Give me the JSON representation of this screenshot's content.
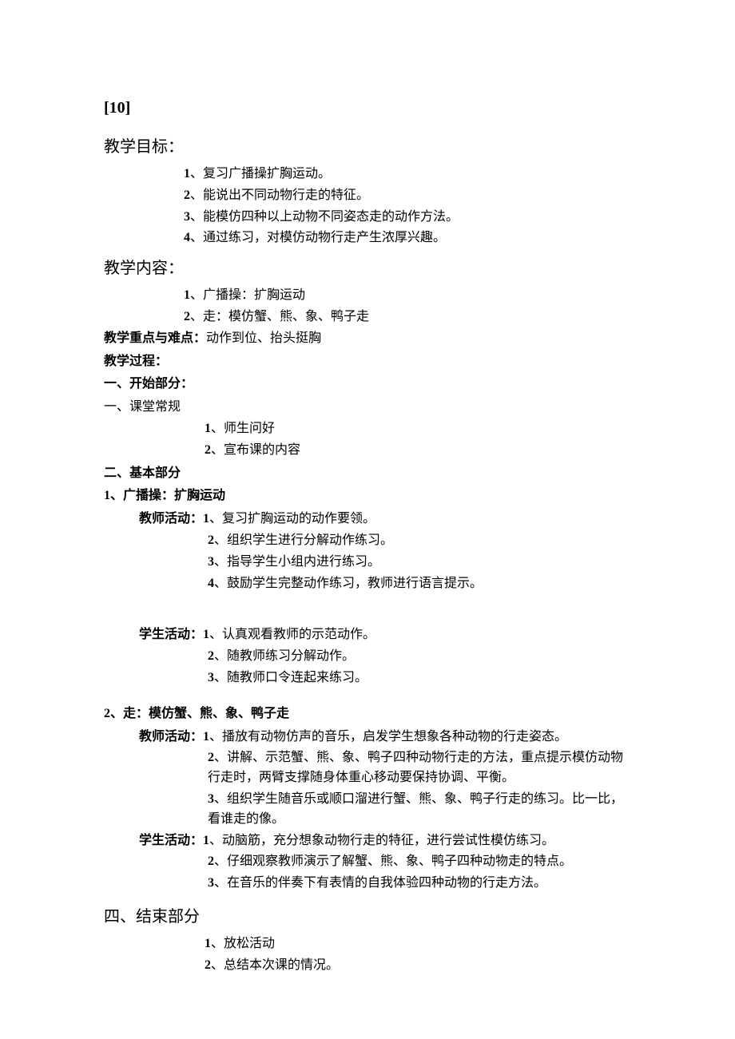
{
  "lesson_no": "[10]",
  "sections": {
    "objectives": {
      "title": "教学目标：",
      "items": [
        "复习广播操扩胸运动。",
        "能说出不同动物行走的特征。",
        "能模仿四种以上动物不同姿态走的动作方法。",
        "通过练习，对模仿动物行走产生浓厚兴趣。"
      ]
    },
    "content": {
      "title": "教学内容：",
      "items": [
        "广播操：扩胸运动",
        "走：模仿蟹、熊、象、鸭子走"
      ]
    },
    "key_label": "教学重点与难点：",
    "key_text": "动作到位、抬头挺胸",
    "process_label": "教学过程：",
    "part1": {
      "title": "一、开始部分：",
      "sub_label": "一、课堂常规",
      "items": [
        "师生问好",
        "宣布课的内容"
      ]
    },
    "part2": {
      "title": "二、基本部分",
      "sub1": {
        "title_num": "1",
        "title": "、广播操：扩胸运动",
        "teacher_label": "教师活动：",
        "teacher_items": [
          "复习扩胸运动的动作要领。",
          "组织学生进行分解动作练习。",
          "指导学生小组内进行练习。",
          "鼓励学生完整动作练习，教师进行语言提示。"
        ],
        "student_label": "学生活动：",
        "student_items": [
          "认真观看教师的示范动作。",
          "随教师练习分解动作。",
          "随教师口令连起来练习。"
        ]
      },
      "sub2": {
        "title_num": "2",
        "title": "、走：模仿蟹、熊、象、鸭子走",
        "teacher_label": "教师活动：",
        "teacher_items": [
          "播放有动物仿声的音乐，启发学生想象各种动物的行走姿态。",
          "讲解、示范蟹、熊、象、鸭子四种动物行走的方法，重点提示模仿动物行走时，两臂支撑随身体重心移动要保持协调、平衡。",
          "组织学生随音乐或顺口溜进行蟹、熊、象、鸭子行走的练习。比一比，看谁走的像。"
        ],
        "student_label": "学生活动：",
        "student_items": [
          "动脑筋，充分想象动物行走的特征，进行尝试性模仿练习。",
          "仔细观察教师演示了解蟹、熊、象、鸭子四种动物走的特点。",
          "在音乐的伴奏下有表情的自我体验四种动物的行走方法。"
        ]
      }
    },
    "part4": {
      "title": "四、结束部分",
      "items": [
        "放松活动",
        "总结本次课的情况。"
      ]
    }
  }
}
